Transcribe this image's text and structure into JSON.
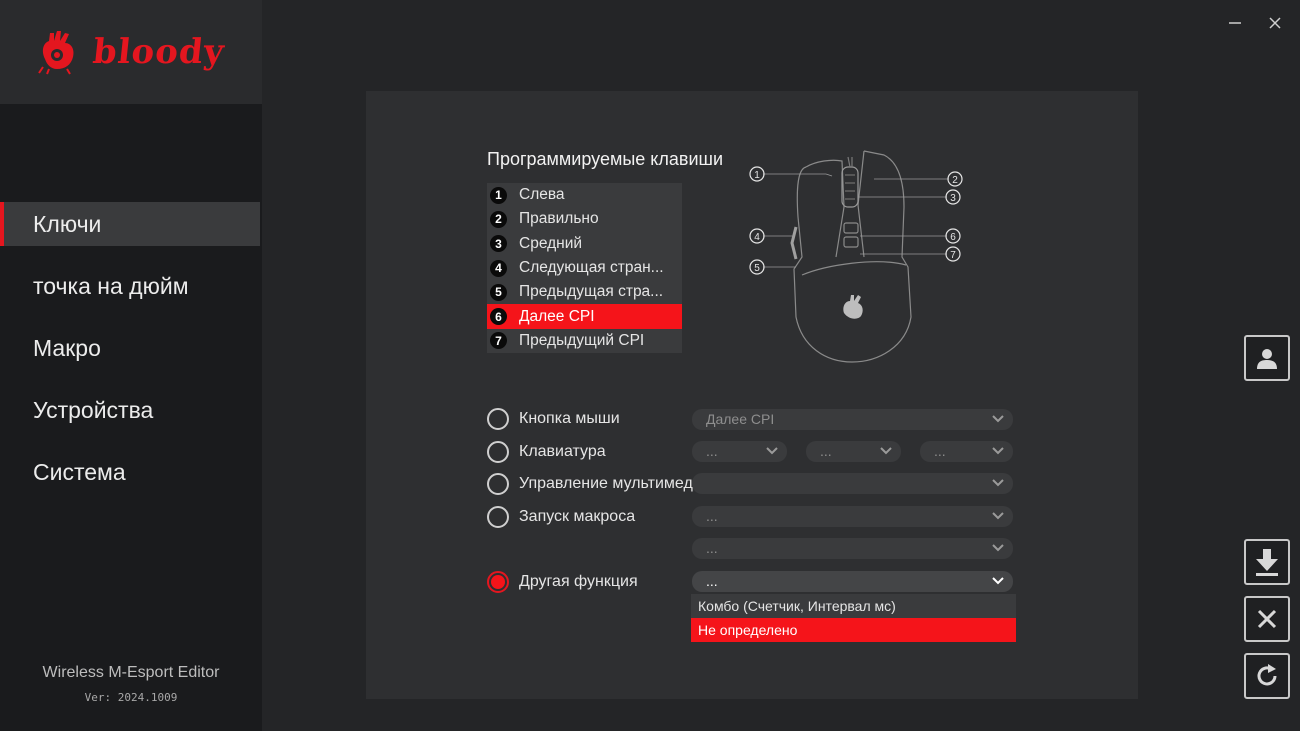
{
  "app": {
    "logo_text": "bloody",
    "name": "Wireless M-Esport Editor",
    "version": "Ver: 2024.1009",
    "accent_color": "#e4161f"
  },
  "window": {
    "minimize_label": "–",
    "close_label": "✕"
  },
  "sidebar": {
    "items": [
      {
        "label": "Ключи",
        "active": true
      },
      {
        "label": "точка на дюйм",
        "active": false
      },
      {
        "label": "Макро",
        "active": false
      },
      {
        "label": "Устройства",
        "active": false
      },
      {
        "label": "Система",
        "active": false
      }
    ]
  },
  "panel": {
    "title": "Программируемые клавиши",
    "keys": [
      {
        "num": "1",
        "label": "Слева"
      },
      {
        "num": "2",
        "label": "Правильно"
      },
      {
        "num": "3",
        "label": "Средний"
      },
      {
        "num": "4",
        "label": "Следующая стран..."
      },
      {
        "num": "5",
        "label": "Предыдущая стра..."
      },
      {
        "num": "6",
        "label": "Далее CPI",
        "selected": true
      },
      {
        "num": "7",
        "label": "Предыдущий CPI"
      }
    ],
    "mouse_callouts": [
      "1",
      "2",
      "3",
      "4",
      "5",
      "6",
      "7"
    ],
    "functions": {
      "mouse_button": {
        "label": "Кнопка мыши",
        "value": "Далее CPI",
        "checked": false
      },
      "keyboard": {
        "label": "Клавиатура",
        "values": [
          "...",
          "...",
          "..."
        ],
        "checked": false
      },
      "multimedia": {
        "label": "Управление мультимедиа",
        "value": "",
        "checked": false
      },
      "macro": {
        "label": "Запуск макроса",
        "value": "...",
        "extra_value": "...",
        "checked": false
      },
      "other": {
        "label": "Другая функция",
        "value": "...",
        "checked": true
      }
    },
    "other_options": [
      {
        "label": "Комбо (Счетчик, Интервал мс)",
        "selected": false
      },
      {
        "label": "Не определено",
        "selected": true
      }
    ]
  },
  "right_toolbar": {
    "profile_icon": "user-icon",
    "apply_icon": "download-arrow-icon",
    "cancel_icon": "close-icon",
    "reset_icon": "refresh-icon"
  }
}
